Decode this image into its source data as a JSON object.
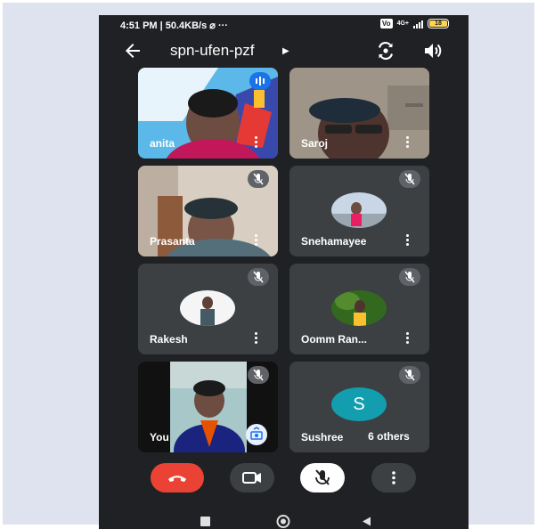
{
  "status": {
    "time_info": "4:51 PM | 50.4KB/s",
    "sim_badge": "Vo",
    "network": "4G+",
    "battery": "18"
  },
  "header": {
    "meeting_code": "spn-ufen-pzf"
  },
  "participants": [
    {
      "name": "anita",
      "muted": false,
      "speaking": true
    },
    {
      "name": "Saroj",
      "muted": false
    },
    {
      "name": "Prasanta",
      "muted": true
    },
    {
      "name": "Snehamayee",
      "muted": true
    },
    {
      "name": "Rakesh",
      "muted": true
    },
    {
      "name": "Oomm Ran...",
      "muted": true
    },
    {
      "name": "You",
      "muted": true
    },
    {
      "name": "Sushree",
      "muted": true,
      "initial": "S"
    }
  ],
  "others_label": "6 others",
  "colors": {
    "end_call": "#ea4335",
    "accent_teal": "#129eaf",
    "tile_bg": "#3c4043",
    "bg": "#202124"
  },
  "icons": [
    "back-arrow-icon",
    "switch-camera-icon",
    "speaker-icon",
    "mic-off-icon",
    "more-vert-icon",
    "end-call-icon",
    "camera-icon",
    "audio-icon"
  ]
}
